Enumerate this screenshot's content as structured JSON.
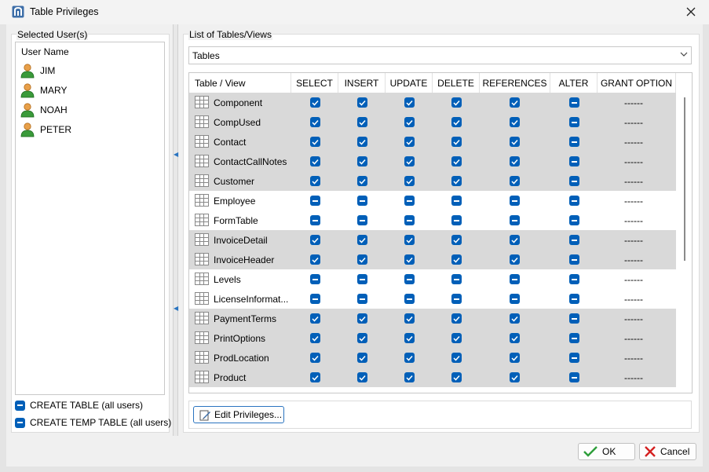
{
  "window": {
    "title": "Table Privileges",
    "close_icon": "close-icon"
  },
  "left": {
    "legend": "Selected User(s)",
    "column_header": "User Name",
    "users": [
      "JIM",
      "MARY",
      "NOAH",
      "PETER"
    ],
    "permissions": [
      "CREATE TABLE (all users)",
      "CREATE TEMP TABLE (all users)"
    ]
  },
  "right": {
    "legend": "List of Tables/Views",
    "object_type": "Tables",
    "columns": [
      "Table / View",
      "SELECT",
      "INSERT",
      "UPDATE",
      "DELETE",
      "REFERENCES",
      "ALTER",
      "GRANT OPTION"
    ],
    "rows": [
      {
        "name": "Component",
        "checked": true,
        "grant": "------"
      },
      {
        "name": "CompUsed",
        "checked": true,
        "grant": "------"
      },
      {
        "name": "Contact",
        "checked": true,
        "grant": "------"
      },
      {
        "name": "ContactCallNotes",
        "checked": true,
        "grant": "------"
      },
      {
        "name": "Customer",
        "checked": true,
        "grant": "------"
      },
      {
        "name": "Employee",
        "checked": false,
        "grant": "------"
      },
      {
        "name": "FormTable",
        "checked": false,
        "grant": "------"
      },
      {
        "name": "InvoiceDetail",
        "checked": true,
        "grant": "------"
      },
      {
        "name": "InvoiceHeader",
        "checked": true,
        "grant": "------"
      },
      {
        "name": "Levels",
        "checked": false,
        "grant": "------"
      },
      {
        "name": "LicenseInformat...",
        "checked": false,
        "grant": "------"
      },
      {
        "name": "PaymentTerms",
        "checked": true,
        "grant": "------"
      },
      {
        "name": "PrintOptions",
        "checked": true,
        "grant": "------"
      },
      {
        "name": "ProdLocation",
        "checked": true,
        "grant": "------"
      },
      {
        "name": "Product",
        "checked": true,
        "grant": "------"
      }
    ],
    "edit_button": "Edit Privileges..."
  },
  "footer": {
    "ok": "OK",
    "cancel": "Cancel"
  },
  "colors": {
    "accent": "#005fb8",
    "row_highlight": "#d9d9d9",
    "cancel_red": "#d42020",
    "ok_green": "#2e9e3a"
  }
}
